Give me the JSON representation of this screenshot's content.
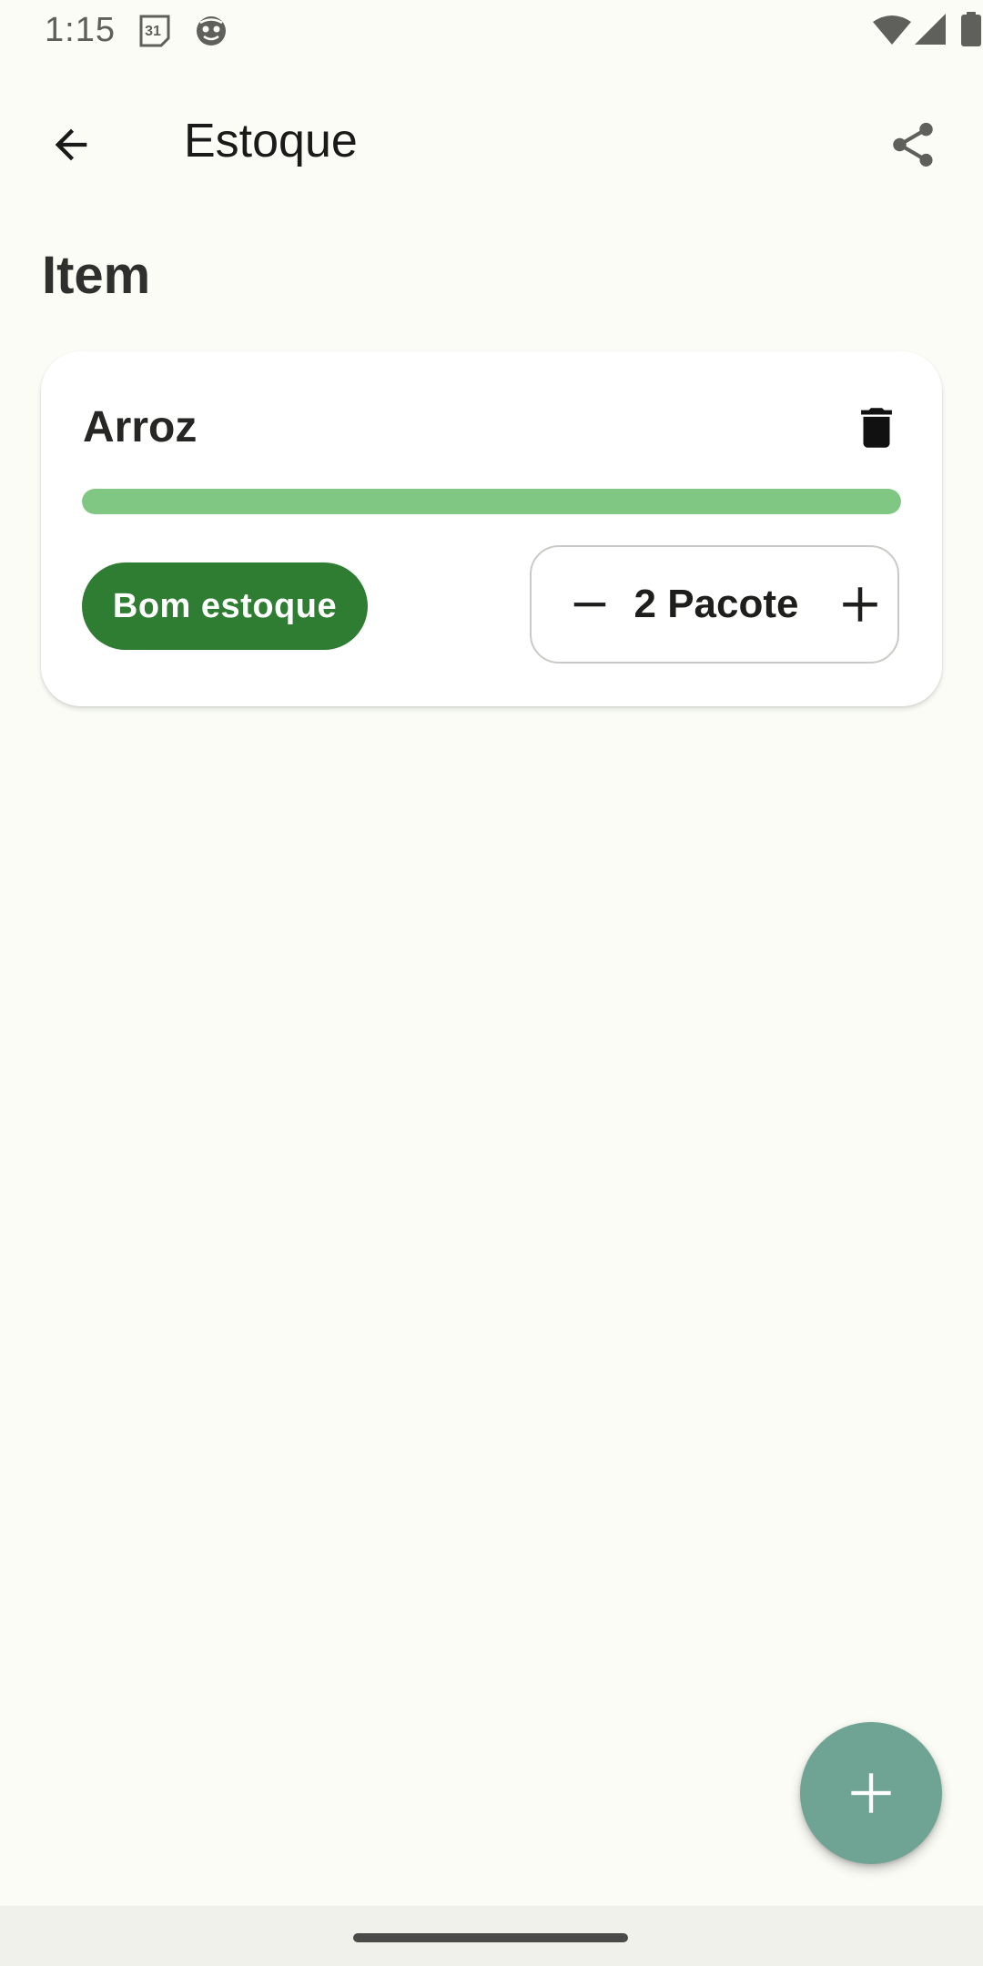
{
  "status_bar": {
    "time": "1:15",
    "calendar_day": "31",
    "icons": [
      "calendar-icon",
      "app-notification-icon",
      "wifi-icon",
      "signal-icon",
      "battery-icon"
    ]
  },
  "app_bar": {
    "title": "Estoque",
    "back_icon": "arrow-back-icon",
    "share_icon": "share-icon"
  },
  "section": {
    "title": "Item"
  },
  "items": [
    {
      "name": "Arroz",
      "stock_level": 1.0,
      "status_label": "Bom estoque",
      "quantity_display": "2 Pacote",
      "quantity": 2,
      "unit": "Pacote",
      "delete_icon": "trash-icon",
      "decrement_icon": "minus-icon",
      "increment_icon": "plus-icon"
    }
  ],
  "fab": {
    "icon": "plus-icon"
  },
  "colors": {
    "background": "#FBFCF6",
    "progress": "#81C784",
    "badge": "#2E7D32",
    "fab": "#6FA393"
  }
}
